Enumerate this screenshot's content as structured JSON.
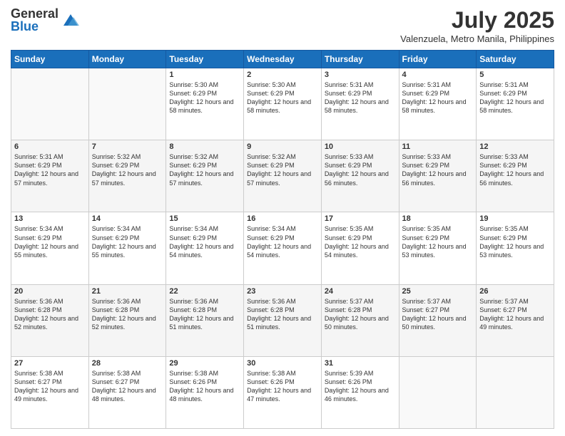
{
  "header": {
    "logo_general": "General",
    "logo_blue": "Blue",
    "month_title": "July 2025",
    "location": "Valenzuela, Metro Manila, Philippines"
  },
  "days_of_week": [
    "Sunday",
    "Monday",
    "Tuesday",
    "Wednesday",
    "Thursday",
    "Friday",
    "Saturday"
  ],
  "weeks": [
    [
      {
        "day": "",
        "sunrise": "",
        "sunset": "",
        "daylight": ""
      },
      {
        "day": "",
        "sunrise": "",
        "sunset": "",
        "daylight": ""
      },
      {
        "day": "1",
        "sunrise": "Sunrise: 5:30 AM",
        "sunset": "Sunset: 6:29 PM",
        "daylight": "Daylight: 12 hours and 58 minutes."
      },
      {
        "day": "2",
        "sunrise": "Sunrise: 5:30 AM",
        "sunset": "Sunset: 6:29 PM",
        "daylight": "Daylight: 12 hours and 58 minutes."
      },
      {
        "day": "3",
        "sunrise": "Sunrise: 5:31 AM",
        "sunset": "Sunset: 6:29 PM",
        "daylight": "Daylight: 12 hours and 58 minutes."
      },
      {
        "day": "4",
        "sunrise": "Sunrise: 5:31 AM",
        "sunset": "Sunset: 6:29 PM",
        "daylight": "Daylight: 12 hours and 58 minutes."
      },
      {
        "day": "5",
        "sunrise": "Sunrise: 5:31 AM",
        "sunset": "Sunset: 6:29 PM",
        "daylight": "Daylight: 12 hours and 58 minutes."
      }
    ],
    [
      {
        "day": "6",
        "sunrise": "Sunrise: 5:31 AM",
        "sunset": "Sunset: 6:29 PM",
        "daylight": "Daylight: 12 hours and 57 minutes."
      },
      {
        "day": "7",
        "sunrise": "Sunrise: 5:32 AM",
        "sunset": "Sunset: 6:29 PM",
        "daylight": "Daylight: 12 hours and 57 minutes."
      },
      {
        "day": "8",
        "sunrise": "Sunrise: 5:32 AM",
        "sunset": "Sunset: 6:29 PM",
        "daylight": "Daylight: 12 hours and 57 minutes."
      },
      {
        "day": "9",
        "sunrise": "Sunrise: 5:32 AM",
        "sunset": "Sunset: 6:29 PM",
        "daylight": "Daylight: 12 hours and 57 minutes."
      },
      {
        "day": "10",
        "sunrise": "Sunrise: 5:33 AM",
        "sunset": "Sunset: 6:29 PM",
        "daylight": "Daylight: 12 hours and 56 minutes."
      },
      {
        "day": "11",
        "sunrise": "Sunrise: 5:33 AM",
        "sunset": "Sunset: 6:29 PM",
        "daylight": "Daylight: 12 hours and 56 minutes."
      },
      {
        "day": "12",
        "sunrise": "Sunrise: 5:33 AM",
        "sunset": "Sunset: 6:29 PM",
        "daylight": "Daylight: 12 hours and 56 minutes."
      }
    ],
    [
      {
        "day": "13",
        "sunrise": "Sunrise: 5:34 AM",
        "sunset": "Sunset: 6:29 PM",
        "daylight": "Daylight: 12 hours and 55 minutes."
      },
      {
        "day": "14",
        "sunrise": "Sunrise: 5:34 AM",
        "sunset": "Sunset: 6:29 PM",
        "daylight": "Daylight: 12 hours and 55 minutes."
      },
      {
        "day": "15",
        "sunrise": "Sunrise: 5:34 AM",
        "sunset": "Sunset: 6:29 PM",
        "daylight": "Daylight: 12 hours and 54 minutes."
      },
      {
        "day": "16",
        "sunrise": "Sunrise: 5:34 AM",
        "sunset": "Sunset: 6:29 PM",
        "daylight": "Daylight: 12 hours and 54 minutes."
      },
      {
        "day": "17",
        "sunrise": "Sunrise: 5:35 AM",
        "sunset": "Sunset: 6:29 PM",
        "daylight": "Daylight: 12 hours and 54 minutes."
      },
      {
        "day": "18",
        "sunrise": "Sunrise: 5:35 AM",
        "sunset": "Sunset: 6:29 PM",
        "daylight": "Daylight: 12 hours and 53 minutes."
      },
      {
        "day": "19",
        "sunrise": "Sunrise: 5:35 AM",
        "sunset": "Sunset: 6:29 PM",
        "daylight": "Daylight: 12 hours and 53 minutes."
      }
    ],
    [
      {
        "day": "20",
        "sunrise": "Sunrise: 5:36 AM",
        "sunset": "Sunset: 6:28 PM",
        "daylight": "Daylight: 12 hours and 52 minutes."
      },
      {
        "day": "21",
        "sunrise": "Sunrise: 5:36 AM",
        "sunset": "Sunset: 6:28 PM",
        "daylight": "Daylight: 12 hours and 52 minutes."
      },
      {
        "day": "22",
        "sunrise": "Sunrise: 5:36 AM",
        "sunset": "Sunset: 6:28 PM",
        "daylight": "Daylight: 12 hours and 51 minutes."
      },
      {
        "day": "23",
        "sunrise": "Sunrise: 5:36 AM",
        "sunset": "Sunset: 6:28 PM",
        "daylight": "Daylight: 12 hours and 51 minutes."
      },
      {
        "day": "24",
        "sunrise": "Sunrise: 5:37 AM",
        "sunset": "Sunset: 6:28 PM",
        "daylight": "Daylight: 12 hours and 50 minutes."
      },
      {
        "day": "25",
        "sunrise": "Sunrise: 5:37 AM",
        "sunset": "Sunset: 6:27 PM",
        "daylight": "Daylight: 12 hours and 50 minutes."
      },
      {
        "day": "26",
        "sunrise": "Sunrise: 5:37 AM",
        "sunset": "Sunset: 6:27 PM",
        "daylight": "Daylight: 12 hours and 49 minutes."
      }
    ],
    [
      {
        "day": "27",
        "sunrise": "Sunrise: 5:38 AM",
        "sunset": "Sunset: 6:27 PM",
        "daylight": "Daylight: 12 hours and 49 minutes."
      },
      {
        "day": "28",
        "sunrise": "Sunrise: 5:38 AM",
        "sunset": "Sunset: 6:27 PM",
        "daylight": "Daylight: 12 hours and 48 minutes."
      },
      {
        "day": "29",
        "sunrise": "Sunrise: 5:38 AM",
        "sunset": "Sunset: 6:26 PM",
        "daylight": "Daylight: 12 hours and 48 minutes."
      },
      {
        "day": "30",
        "sunrise": "Sunrise: 5:38 AM",
        "sunset": "Sunset: 6:26 PM",
        "daylight": "Daylight: 12 hours and 47 minutes."
      },
      {
        "day": "31",
        "sunrise": "Sunrise: 5:39 AM",
        "sunset": "Sunset: 6:26 PM",
        "daylight": "Daylight: 12 hours and 46 minutes."
      },
      {
        "day": "",
        "sunrise": "",
        "sunset": "",
        "daylight": ""
      },
      {
        "day": "",
        "sunrise": "",
        "sunset": "",
        "daylight": ""
      }
    ]
  ]
}
